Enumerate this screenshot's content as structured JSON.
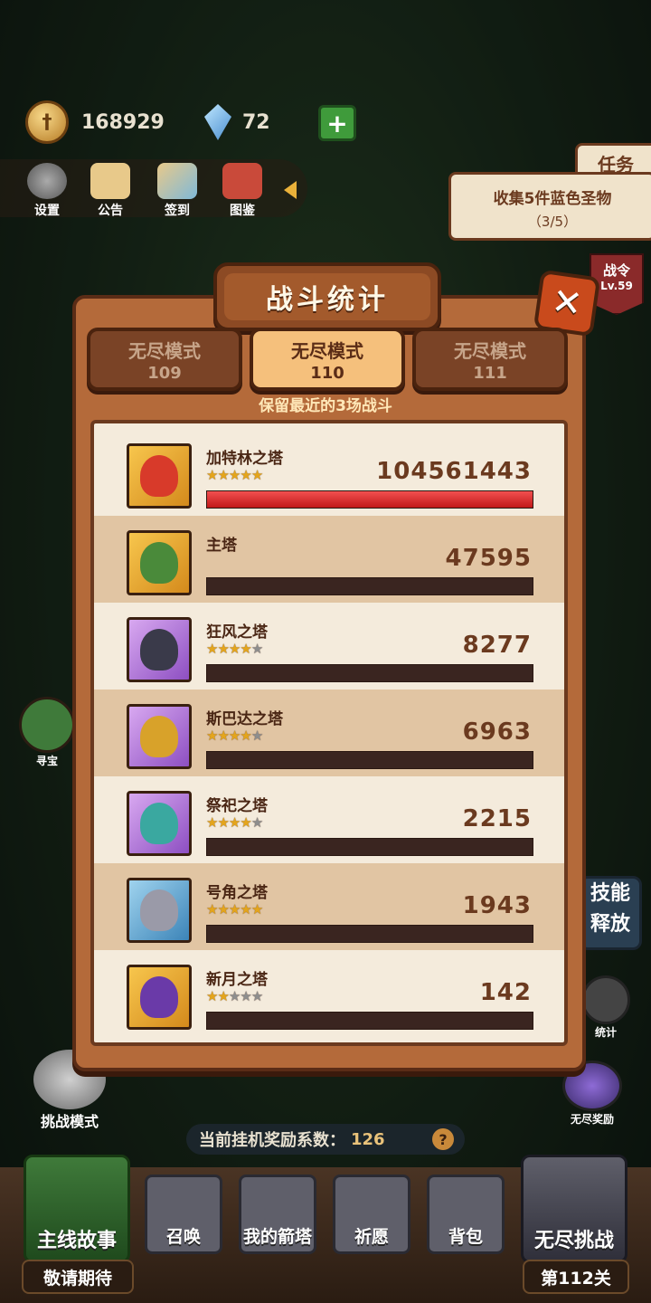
{
  "resources": {
    "gold": "168929",
    "gems": "72"
  },
  "top_menu": [
    {
      "label": "设置"
    },
    {
      "label": "公告"
    },
    {
      "label": "签到"
    },
    {
      "label": "图鉴"
    }
  ],
  "quest": {
    "tab": "任务",
    "text": "收集5件蓝色圣物",
    "progress": "（3/5）"
  },
  "battle_pass": {
    "label": "战令",
    "level": "Lv.59"
  },
  "panel": {
    "title": "战斗统计",
    "close": "✕",
    "tabs": [
      {
        "mode": "无尽模式",
        "wave": "109",
        "active": false
      },
      {
        "mode": "无尽模式",
        "wave": "110",
        "active": true
      },
      {
        "mode": "无尽模式",
        "wave": "111",
        "active": false
      }
    ],
    "note": "保留最近的3场战斗",
    "towers": [
      {
        "name": "加特林之塔",
        "stars": 5,
        "damage": "104561443",
        "fill": 1.0,
        "frame": "gold"
      },
      {
        "name": "主塔",
        "stars": 0,
        "damage": "47595",
        "fill": 0.0,
        "frame": "gold"
      },
      {
        "name": "狂风之塔",
        "stars": 4,
        "damage": "8277",
        "fill": 0.0,
        "frame": "purple"
      },
      {
        "name": "斯巴达之塔",
        "stars": 4,
        "damage": "6963",
        "fill": 0.0,
        "frame": "purple"
      },
      {
        "name": "祭祀之塔",
        "stars": 4,
        "damage": "2215",
        "fill": 0.0,
        "frame": "purple"
      },
      {
        "name": "号角之塔",
        "stars": 5,
        "damage": "1943",
        "fill": 0.0,
        "frame": "blue"
      },
      {
        "name": "新月之塔",
        "stars": 2,
        "damage": "142",
        "fill": 0.0,
        "frame": "gold"
      }
    ]
  },
  "side": {
    "treasure": "寻宝",
    "stats": "统计",
    "endless_reward": "无尽奖励",
    "challenge_mode": "挑战模式",
    "skill": "技能释放"
  },
  "idle": {
    "label": "当前挂机奖励系数：",
    "value": "126",
    "help": "?"
  },
  "bottom": {
    "story": "主线故事",
    "story_sub": "敬请期待",
    "summon": "召唤",
    "my_towers": "我的箭塔",
    "wish": "祈愿",
    "bag": "背包",
    "endless": "无尽挑战",
    "endless_sub": "第112关"
  },
  "colors": {
    "panel": "#b46a3a",
    "bar_fill": "#d81f1f",
    "star": "#e4a51c"
  }
}
